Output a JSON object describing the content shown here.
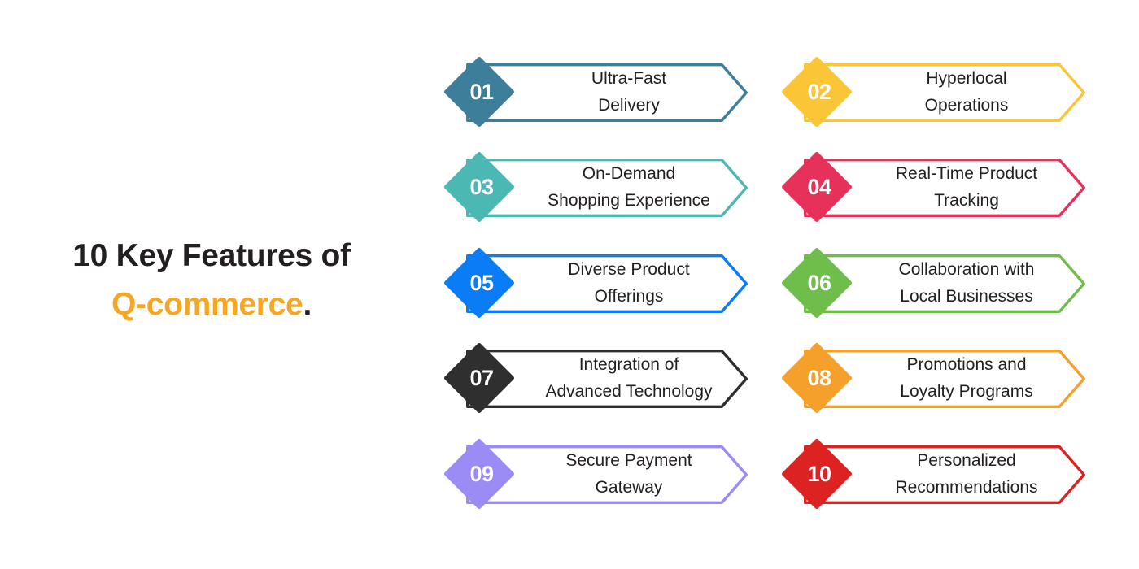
{
  "title": {
    "line1": "10 Key Features of",
    "line2_accent": "Q-commerce",
    "line2_period": ".",
    "accent_color": "#f5a623",
    "text_color": "#231f20"
  },
  "items": [
    {
      "number": "01",
      "label_line1": "Ultra-Fast",
      "label_line2": "Delivery",
      "color": "#3d7e9a",
      "column": "left",
      "row": 0
    },
    {
      "number": "02",
      "label_line1": "Hyperlocal",
      "label_line2": "Operations",
      "color": "#fac537",
      "column": "right",
      "row": 0
    },
    {
      "number": "03",
      "label_line1": "On-Demand",
      "label_line2": "Shopping Experience",
      "color": "#4cb8b3",
      "column": "left",
      "row": 1
    },
    {
      "number": "04",
      "label_line1": "Real-Time Product",
      "label_line2": "Tracking",
      "color": "#e6315a",
      "column": "right",
      "row": 1
    },
    {
      "number": "05",
      "label_line1": "Diverse Product",
      "label_line2": "Offerings",
      "color": "#0a7cf5",
      "column": "left",
      "row": 2
    },
    {
      "number": "06",
      "label_line1": "Collaboration with",
      "label_line2": "Local Businesses",
      "color": "#6fbd4a",
      "column": "right",
      "row": 2
    },
    {
      "number": "07",
      "label_line1": "Integration of",
      "label_line2": "Advanced Technology",
      "color": "#2f2f2f",
      "column": "left",
      "row": 3
    },
    {
      "number": "08",
      "label_line1": "Promotions and",
      "label_line2": "Loyalty Programs",
      "color": "#f5a02a",
      "column": "right",
      "row": 3
    },
    {
      "number": "09",
      "label_line1": "Secure Payment",
      "label_line2": "Gateway",
      "color": "#9b8cf5",
      "column": "left",
      "row": 4
    },
    {
      "number": "10",
      "label_line1": "Personalized",
      "label_line2": "Recommendations",
      "color": "#dd2222",
      "column": "right",
      "row": 4
    }
  ]
}
